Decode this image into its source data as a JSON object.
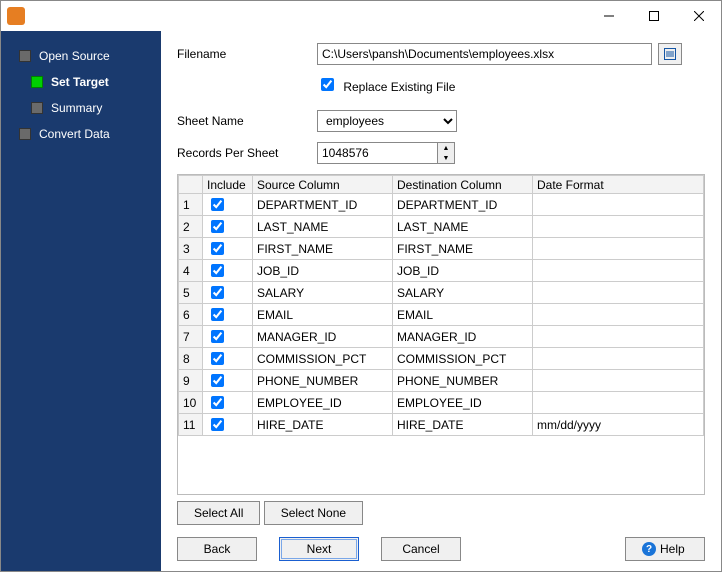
{
  "sidebar": {
    "items": [
      {
        "label": "Open Source",
        "active": false
      },
      {
        "label": "Set Target",
        "active": true
      },
      {
        "label": "Summary",
        "active": false
      },
      {
        "label": "Convert Data",
        "active": false
      }
    ]
  },
  "form": {
    "filename_label": "Filename",
    "filename_value": "C:\\Users\\pansh\\Documents\\employees.xlsx",
    "replace_label": "Replace Existing File",
    "replace_checked": true,
    "sheet_label": "Sheet Name",
    "sheet_value": "employees",
    "records_label": "Records Per Sheet",
    "records_value": "1048576"
  },
  "grid": {
    "headers": {
      "include": "Include",
      "source": "Source Column",
      "dest": "Destination Column",
      "datefmt": "Date Format"
    },
    "rows": [
      {
        "n": "1",
        "inc": true,
        "src": "DEPARTMENT_ID",
        "dst": "DEPARTMENT_ID",
        "fmt": ""
      },
      {
        "n": "2",
        "inc": true,
        "src": "LAST_NAME",
        "dst": "LAST_NAME",
        "fmt": ""
      },
      {
        "n": "3",
        "inc": true,
        "src": "FIRST_NAME",
        "dst": "FIRST_NAME",
        "fmt": ""
      },
      {
        "n": "4",
        "inc": true,
        "src": "JOB_ID",
        "dst": "JOB_ID",
        "fmt": ""
      },
      {
        "n": "5",
        "inc": true,
        "src": "SALARY",
        "dst": "SALARY",
        "fmt": ""
      },
      {
        "n": "6",
        "inc": true,
        "src": "EMAIL",
        "dst": "EMAIL",
        "fmt": ""
      },
      {
        "n": "7",
        "inc": true,
        "src": "MANAGER_ID",
        "dst": "MANAGER_ID",
        "fmt": ""
      },
      {
        "n": "8",
        "inc": true,
        "src": "COMMISSION_PCT",
        "dst": "COMMISSION_PCT",
        "fmt": ""
      },
      {
        "n": "9",
        "inc": true,
        "src": "PHONE_NUMBER",
        "dst": "PHONE_NUMBER",
        "fmt": ""
      },
      {
        "n": "10",
        "inc": true,
        "src": "EMPLOYEE_ID",
        "dst": "EMPLOYEE_ID",
        "fmt": ""
      },
      {
        "n": "11",
        "inc": true,
        "src": "HIRE_DATE",
        "dst": "HIRE_DATE",
        "fmt": "mm/dd/yyyy"
      }
    ]
  },
  "buttons": {
    "select_all": "Select All",
    "select_none": "Select None",
    "back": "Back",
    "next": "Next",
    "cancel": "Cancel",
    "help": "Help"
  }
}
